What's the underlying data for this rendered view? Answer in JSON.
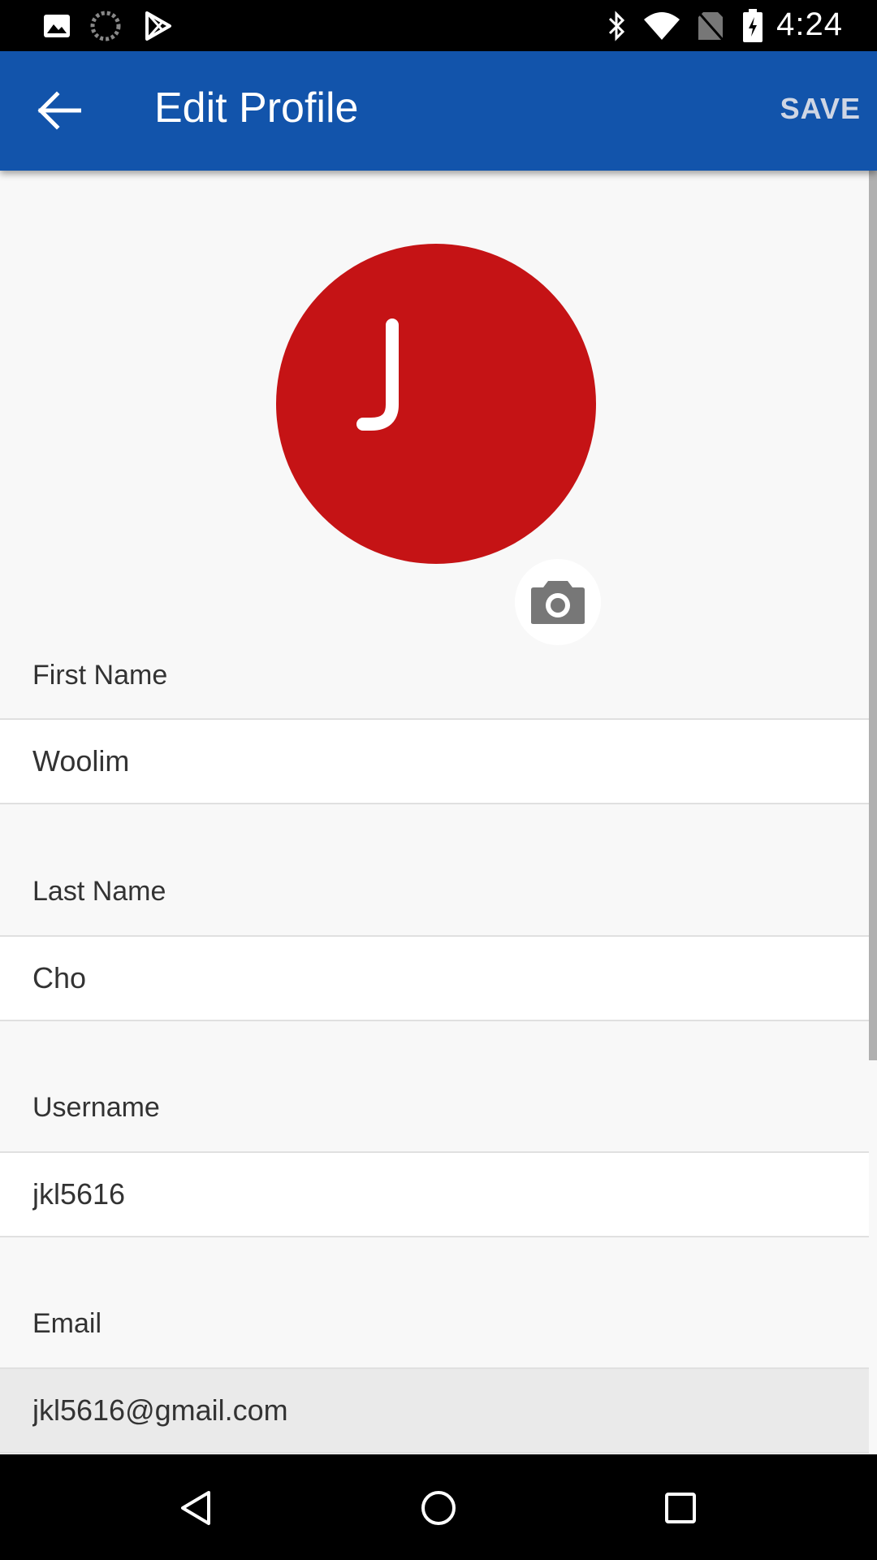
{
  "status_bar": {
    "time": "4:24",
    "left_icons": [
      "image-icon",
      "loading-icon",
      "play-store-icon"
    ],
    "right_icons": [
      "bluetooth-icon",
      "wifi-icon",
      "no-sim-icon",
      "battery-icon"
    ]
  },
  "app_bar": {
    "title": "Edit Profile",
    "save_label": "SAVE",
    "color": "#1254ab"
  },
  "avatar": {
    "initial": "J",
    "color": "#c51315"
  },
  "fields": {
    "first_name": {
      "label": "First Name",
      "value": "Woolim"
    },
    "last_name": {
      "label": "Last Name",
      "value": "Cho"
    },
    "username": {
      "label": "Username",
      "value": "jkl5616"
    },
    "email": {
      "label": "Email",
      "value": "jkl5616@gmail.com"
    }
  },
  "nav_bar": {
    "buttons": [
      "back-triangle-icon",
      "home-circle-icon",
      "recents-square-icon"
    ]
  }
}
